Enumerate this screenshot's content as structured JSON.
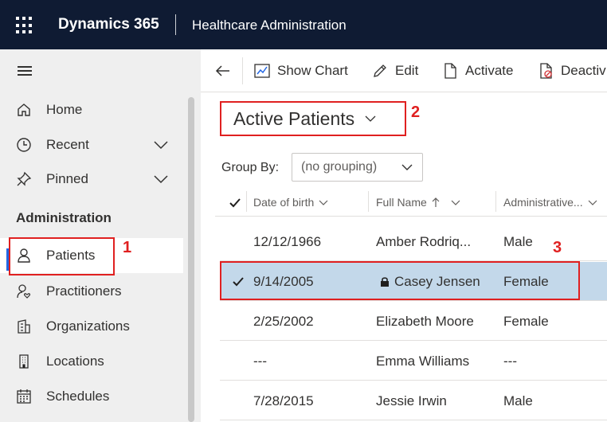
{
  "header": {
    "brand": "Dynamics 365",
    "app_title": "Healthcare Administration"
  },
  "sidebar": {
    "items_top": [
      {
        "label": "Home",
        "icon": "home-icon"
      },
      {
        "label": "Recent",
        "icon": "clock-icon"
      },
      {
        "label": "Pinned",
        "icon": "pin-icon"
      }
    ],
    "section_header": "Administration",
    "items": [
      {
        "label": "Patients",
        "icon": "person-icon",
        "selected": true
      },
      {
        "label": "Practitioners",
        "icon": "person-heart-icon"
      },
      {
        "label": "Organizations",
        "icon": "building-icon"
      },
      {
        "label": "Locations",
        "icon": "location-building-icon"
      },
      {
        "label": "Schedules",
        "icon": "calendar-icon"
      }
    ]
  },
  "commandbar": {
    "show_chart": "Show Chart",
    "edit": "Edit",
    "activate": "Activate",
    "deactivate": "Deactiv"
  },
  "view": {
    "title": "Active Patients"
  },
  "groupby": {
    "label": "Group By:",
    "value": "(no grouping)"
  },
  "grid": {
    "columns": [
      "Date of birth",
      "Full Name",
      "Administrative..."
    ],
    "rows": [
      {
        "dob": "12/12/1966",
        "name": "Amber Rodriq...",
        "gender": "Male",
        "selected": false,
        "locked": false
      },
      {
        "dob": "9/14/2005",
        "name": "Casey Jensen",
        "gender": "Female",
        "selected": true,
        "locked": true
      },
      {
        "dob": "2/25/2002",
        "name": "Elizabeth Moore",
        "gender": "Female",
        "selected": false,
        "locked": false
      },
      {
        "dob": "---",
        "name": "Emma Williams",
        "gender": "---",
        "selected": false,
        "locked": false
      },
      {
        "dob": "7/28/2015",
        "name": "Jessie Irwin",
        "gender": "Male",
        "selected": false,
        "locked": false
      }
    ]
  },
  "callouts": {
    "one": "1",
    "two": "2",
    "three": "3"
  },
  "colors": {
    "topbar": "#0f1b33",
    "selected_row": "#c3d8ea",
    "callout_red": "#e02020",
    "selection_accent": "#2266e3"
  }
}
